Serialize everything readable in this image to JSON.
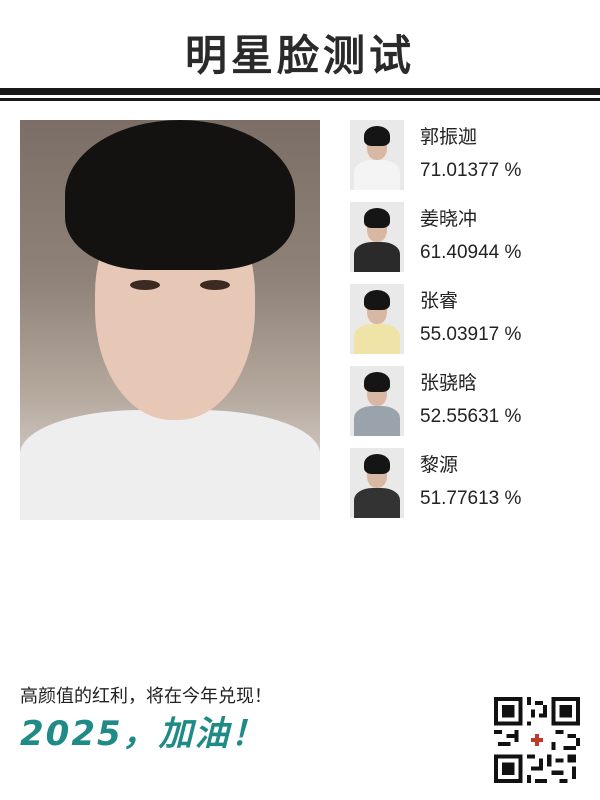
{
  "header": {
    "title": "明星脸测试"
  },
  "results": [
    {
      "name": "郭振迦",
      "score": "71.01377 %",
      "shirt": "#f4f4f4"
    },
    {
      "name": "姜晓冲",
      "score": "61.40944 %",
      "shirt": "#2a2a2a"
    },
    {
      "name": "张睿",
      "score": "55.03917 %",
      "shirt": "#efe3a8"
    },
    {
      "name": "张骁晗",
      "score": "52.55631 %",
      "shirt": "#9aa3ab"
    },
    {
      "name": "黎源",
      "score": "51.77613 %",
      "shirt": "#333333"
    }
  ],
  "footer": {
    "slogan": "高颜值的红利，将在今年兑现！",
    "motto": "2025，加油！"
  },
  "colors": {
    "accent": "#1f8a86",
    "rule": "#1a1a1a"
  },
  "icons": {
    "qr": "qr-code-icon"
  }
}
